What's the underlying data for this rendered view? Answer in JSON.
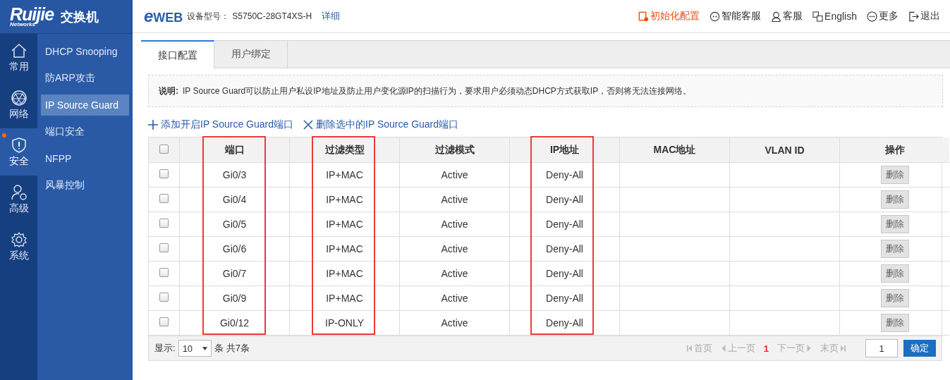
{
  "brand": {
    "logo": "Ruijie",
    "logo_sub": "Networks",
    "product": "交换机"
  },
  "header": {
    "eweb_e": "e",
    "eweb": "WEB",
    "model_label": "设备型号：",
    "model": "S5750C-28GT4XS-H",
    "detail_link": "详细",
    "actions": [
      {
        "kind": "init",
        "label": "初始化配置",
        "highlighted": true
      },
      {
        "kind": "smart",
        "label": "智能客服",
        "highlighted": false
      },
      {
        "kind": "service",
        "label": "客服",
        "highlighted": false
      },
      {
        "kind": "lang",
        "label": "English",
        "highlighted": false
      },
      {
        "kind": "more",
        "label": "更多",
        "highlighted": false
      },
      {
        "kind": "logout",
        "label": "退出",
        "highlighted": false
      }
    ]
  },
  "nav": [
    {
      "kind": "home",
      "label": "常用",
      "selected": false,
      "alert": false
    },
    {
      "kind": "network",
      "label": "网络",
      "selected": false,
      "alert": false
    },
    {
      "kind": "security",
      "label": "安全",
      "selected": true,
      "alert": true
    },
    {
      "kind": "advanced",
      "label": "高级",
      "selected": false,
      "alert": false
    },
    {
      "kind": "system",
      "label": "系统",
      "selected": false,
      "alert": false
    }
  ],
  "submenu": [
    {
      "label": "DHCP Snooping",
      "selected": false
    },
    {
      "label": "防ARP攻击",
      "selected": false
    },
    {
      "label": "IP Source Guard",
      "selected": true
    },
    {
      "label": "端口安全",
      "selected": false
    },
    {
      "label": "NFPP",
      "selected": false
    },
    {
      "label": "风暴控制",
      "selected": false
    }
  ],
  "tabs": [
    {
      "label": "接口配置",
      "selected": true
    },
    {
      "label": "用户绑定",
      "selected": false
    }
  ],
  "note": {
    "label": "说明:",
    "text": "IP Source Guard可以防止用户私设IP地址及防止用户变化源IP的扫描行为，要求用户必须动态DHCP方式获取IP，否则将无法连接网络。"
  },
  "toolbar": [
    {
      "kind": "add",
      "label": "添加开启IP Source Guard端口"
    },
    {
      "kind": "delete",
      "label": "删除选中的IP Source Guard端口"
    }
  ],
  "table": {
    "columns": [
      {
        "label": "端口",
        "highlighted": true
      },
      {
        "label": "过滤类型",
        "highlighted": true
      },
      {
        "label": "过滤模式",
        "highlighted": false
      },
      {
        "label": "IP地址",
        "highlighted": true
      },
      {
        "label": "MAC地址",
        "highlighted": false
      },
      {
        "label": "VLAN ID",
        "highlighted": false
      },
      {
        "label": "操作",
        "highlighted": false
      }
    ],
    "select_all": {
      "checked": false
    },
    "rows": [
      {
        "checked": false,
        "cells": [
          "Gi0/3",
          "IP+MAC",
          "Active",
          "Deny-All"
        ],
        "action": "删除"
      },
      {
        "checked": false,
        "cells": [
          "Gi0/4",
          "IP+MAC",
          "Active",
          "Deny-All"
        ],
        "action": "删除"
      },
      {
        "checked": false,
        "cells": [
          "Gi0/5",
          "IP+MAC",
          "Active",
          "Deny-All"
        ],
        "action": "删除"
      },
      {
        "checked": false,
        "cells": [
          "Gi0/6",
          "IP+MAC",
          "Active",
          "Deny-All"
        ],
        "action": "删除"
      },
      {
        "checked": false,
        "cells": [
          "Gi0/7",
          "IP+MAC",
          "Active",
          "Deny-All"
        ],
        "action": "删除"
      },
      {
        "checked": false,
        "cells": [
          "Gi0/9",
          "IP+MAC",
          "Active",
          "Deny-All"
        ],
        "action": "删除"
      },
      {
        "checked": false,
        "cells": [
          "Gi0/12",
          "IP-ONLY",
          "Active",
          "Deny-All"
        ],
        "action": "删除"
      }
    ]
  },
  "pager": {
    "show_label": "显示:",
    "page_size": "10",
    "summary": "条 共7条",
    "first": "首页",
    "prev": "上一页",
    "current": "1",
    "next": "下一页",
    "last": "末页",
    "goto": "1",
    "confirm": "确定"
  }
}
